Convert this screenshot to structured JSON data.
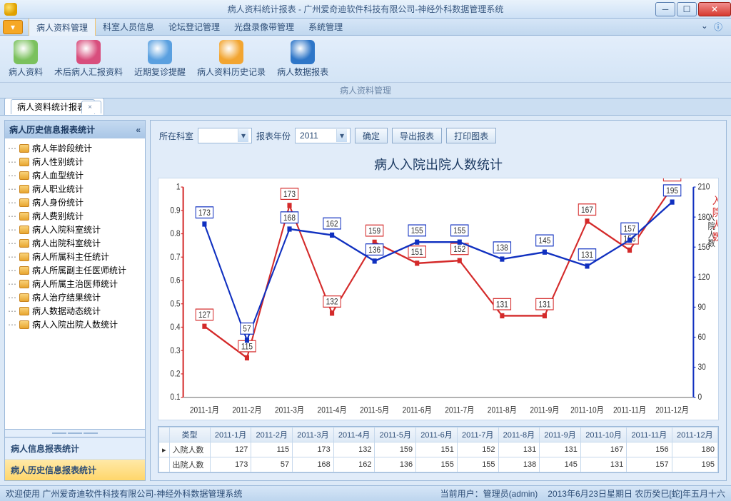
{
  "window": {
    "title": "病人资料统计报表 - 广州爱奇迪软件科技有限公司-神经外科数据管理系统"
  },
  "menubar": {
    "items": [
      "病人资料管理",
      "科室人员信息",
      "论坛登记管理",
      "光盘录像带管理",
      "系统管理"
    ],
    "active_index": 0
  },
  "ribbon": {
    "items": [
      {
        "label": "病人资料",
        "color": "#7bc15e"
      },
      {
        "label": "术后病人汇报资料",
        "color": "#d84e7d"
      },
      {
        "label": "近期复诊提醒",
        "color": "#5aa0e0"
      },
      {
        "label": "病人资料历史记录",
        "color": "#f2a531"
      },
      {
        "label": "病人数据报表",
        "color": "#2e76c8"
      }
    ],
    "group_label": "病人资料管理"
  },
  "doc_tab": {
    "label": "病人资料统计报表"
  },
  "sidebar": {
    "title": "病人历史信息报表统计",
    "tree": [
      "病人年龄段统计",
      "病人性别统计",
      "病人血型统计",
      "病人职业统计",
      "病人身份统计",
      "病人费别统计",
      "病人入院科室统计",
      "病人出院科室统计",
      "病人所属科主任统计",
      "病人所属副主任医师统计",
      "病人所属主治医师统计",
      "病人治疗结果统计",
      "病人数据动态统计",
      "病人入院出院人数统计"
    ],
    "footer1": "病人信息报表统计",
    "footer2": "病人历史信息报表统计"
  },
  "toolbar": {
    "dept_label": "所在科室",
    "year_label": "报表年份",
    "year_value": "2011",
    "btn_ok": "确定",
    "btn_export": "导出报表",
    "btn_print": "打印图表"
  },
  "chart": {
    "title": "病人入院出院人数统计",
    "y1_label": "入院人数",
    "y2_label": "出院人数"
  },
  "chart_data": {
    "type": "line",
    "categories": [
      "2011-1月",
      "2011-2月",
      "2011-3月",
      "2011-4月",
      "2011-5月",
      "2011-6月",
      "2011-7月",
      "2011-8月",
      "2011-9月",
      "2011-10月",
      "2011-11月",
      "2011-12月"
    ],
    "series": [
      {
        "name": "入院人数",
        "color": "#d42a2a",
        "values": [
          127,
          115,
          173,
          132,
          159,
          151,
          152,
          131,
          131,
          167,
          156,
          180
        ],
        "axis": "left",
        "ylim": [
          100,
          180
        ],
        "ticks": [
          0.1,
          0.2,
          0.3,
          0.4,
          0.5,
          0.6,
          0.7,
          0.8,
          0.9,
          1
        ]
      },
      {
        "name": "出院人数",
        "color": "#1030c0",
        "values": [
          173,
          57,
          168,
          162,
          136,
          155,
          155,
          138,
          145,
          131,
          157,
          195
        ],
        "axis": "right",
        "ylim": [
          0,
          210
        ],
        "ticks": [
          0,
          30,
          60,
          90,
          120,
          150,
          180,
          210
        ]
      }
    ],
    "left_ticks": [
      "0.1",
      "0.2",
      "0.3",
      "0.4",
      "0.5",
      "0.6",
      "0.7",
      "0.8",
      "0.9",
      "1"
    ],
    "right_ticks": [
      "0",
      "30",
      "60",
      "90",
      "120",
      "150",
      "180",
      "210"
    ]
  },
  "table": {
    "type_header": "类型",
    "row1_name": "入院人数",
    "row2_name": "出院人数"
  },
  "statusbar": {
    "welcome": "欢迎使用 广州爱奇迪软件科技有限公司-神经外科数据管理系统",
    "user": "当前用户：管理员(admin)",
    "date": "2013年6月23日星期日 农历癸巳[蛇]年五月十六"
  }
}
